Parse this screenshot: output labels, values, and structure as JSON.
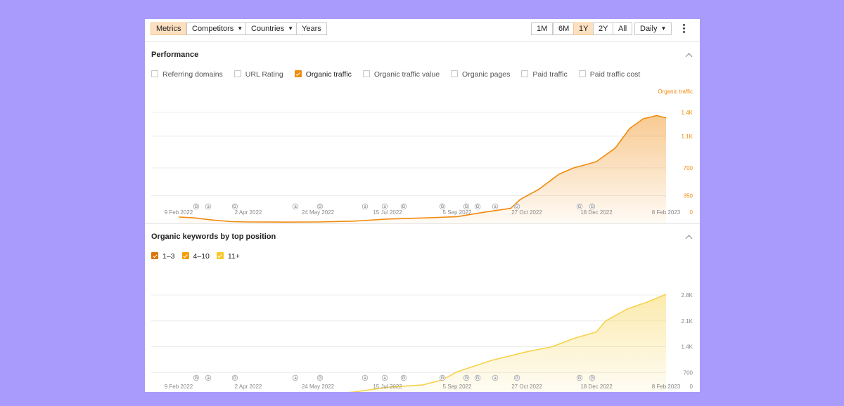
{
  "toolbar": {
    "left_buttons": [
      {
        "label": "Metrics",
        "active": true
      },
      {
        "label": "Competitors",
        "dropdown": true
      },
      {
        "label": "Countries",
        "dropdown": true
      },
      {
        "label": "Years"
      }
    ],
    "ranges": [
      {
        "label": "1M"
      },
      {
        "label": "6M"
      },
      {
        "label": "1Y",
        "active": true
      },
      {
        "label": "2Y"
      },
      {
        "label": "All"
      }
    ],
    "interval": "Daily",
    "menu_icon": "more-vertical-icon"
  },
  "performance": {
    "title": "Performance",
    "collapse_icon": "chevron-up-icon",
    "metrics": [
      {
        "label": "Referring domains",
        "checked": false
      },
      {
        "label": "URL Rating",
        "checked": false
      },
      {
        "label": "Organic traffic",
        "checked": true
      },
      {
        "label": "Organic traffic value",
        "checked": false
      },
      {
        "label": "Organic pages",
        "checked": false
      },
      {
        "label": "Paid traffic",
        "checked": false
      },
      {
        "label": "Paid traffic cost",
        "checked": false
      }
    ]
  },
  "keywords": {
    "title": "Organic keywords by top position",
    "collapse_icon": "chevron-up-icon",
    "positions": [
      {
        "label": "1–3",
        "checked": true,
        "color": "#d97706"
      },
      {
        "label": "4–10",
        "checked": true,
        "color": "#f59e0b"
      },
      {
        "label": "11+",
        "checked": true,
        "color": "#fcd34d"
      }
    ]
  },
  "colors": {
    "accent": "#f08a0c",
    "pos_1_3": "#d97706",
    "pos_4_10": "#f59e0b",
    "pos_11_plus": "#f7d24a",
    "grid": "#ececec"
  },
  "chart_data": [
    {
      "type": "area",
      "x_start": "2022-02-09",
      "x_end": "2023-02-08",
      "x_tick_labels": [
        "9 Feb 2022",
        "2 Apr 2022",
        "24 May 2022",
        "15 Jul 2022",
        "5 Sep 2022",
        "27 Oct 2022",
        "18 Dec 2022",
        "8 Feb 2023"
      ],
      "y_ticks": [
        0,
        350,
        700,
        1100,
        1400
      ],
      "y_tick_labels": [
        "0",
        "350",
        "700",
        "1.1K",
        "1.4K"
      ],
      "ylim": [
        0,
        1400
      ],
      "grid": true,
      "series": [
        {
          "name": "Organic traffic",
          "color": "#f08a0c",
          "points": [
            [
              "2022-02-09",
              80
            ],
            [
              "2022-02-20",
              70
            ],
            [
              "2022-03-05",
              45
            ],
            [
              "2022-03-20",
              22
            ],
            [
              "2022-04-02",
              18
            ],
            [
              "2022-05-01",
              16
            ],
            [
              "2022-05-24",
              18
            ],
            [
              "2022-06-20",
              28
            ],
            [
              "2022-07-15",
              55
            ],
            [
              "2022-08-15",
              70
            ],
            [
              "2022-09-05",
              85
            ],
            [
              "2022-09-25",
              140
            ],
            [
              "2022-10-15",
              190
            ],
            [
              "2022-10-22",
              300
            ],
            [
              "2022-11-05",
              430
            ],
            [
              "2022-11-20",
              620
            ],
            [
              "2022-12-01",
              700
            ],
            [
              "2022-12-10",
              740
            ],
            [
              "2022-12-18",
              780
            ],
            [
              "2023-01-01",
              950
            ],
            [
              "2023-01-12",
              1200
            ],
            [
              "2023-01-22",
              1320
            ],
            [
              "2023-02-01",
              1360
            ],
            [
              "2023-02-08",
              1330
            ]
          ]
        }
      ],
      "annotations": [
        "G",
        "a",
        "G",
        "a",
        "G",
        "a",
        "a",
        "G",
        "G",
        "G",
        "G",
        "a",
        "G",
        "G",
        "G"
      ]
    },
    {
      "type": "area",
      "x_start": "2022-02-09",
      "x_end": "2023-02-08",
      "x_tick_labels": [
        "9 Feb 2022",
        "2 Apr 2022",
        "24 May 2022",
        "15 Jul 2022",
        "5 Sep 2022",
        "27 Oct 2022",
        "18 Dec 2022",
        "8 Feb 2023"
      ],
      "y_ticks": [
        0,
        700,
        1400,
        2100,
        2800
      ],
      "y_tick_labels": [
        "0",
        "700",
        "1.4K",
        "2.1K",
        "2.8K"
      ],
      "ylim": [
        0,
        2800
      ],
      "grid": true,
      "series": [
        {
          "name": "11+",
          "color": "#f7d24a",
          "points": [
            [
              "2022-02-09",
              75
            ],
            [
              "2022-04-02",
              75
            ],
            [
              "2022-05-24",
              95
            ],
            [
              "2022-06-20",
              170
            ],
            [
              "2022-07-15",
              300
            ],
            [
              "2022-08-10",
              360
            ],
            [
              "2022-08-25",
              500
            ],
            [
              "2022-09-05",
              720
            ],
            [
              "2022-10-01",
              1030
            ],
            [
              "2022-10-27",
              1260
            ],
            [
              "2022-11-15",
              1400
            ],
            [
              "2022-12-01",
              1620
            ],
            [
              "2022-12-18",
              1800
            ],
            [
              "2022-12-25",
              2100
            ],
            [
              "2023-01-10",
              2420
            ],
            [
              "2023-01-25",
              2610
            ],
            [
              "2023-02-08",
              2820
            ]
          ]
        },
        {
          "name": "4–10",
          "color": "#f59e0b",
          "points": [
            [
              "2022-02-09",
              22
            ],
            [
              "2022-09-05",
              26
            ],
            [
              "2022-12-18",
              50
            ],
            [
              "2023-01-20",
              95
            ],
            [
              "2023-02-08",
              100
            ]
          ]
        },
        {
          "name": "1–3",
          "color": "#d97706",
          "points": [
            [
              "2022-02-09",
              10
            ],
            [
              "2022-12-18",
              14
            ],
            [
              "2023-02-08",
              18
            ]
          ]
        }
      ],
      "annotations": [
        "G",
        "a",
        "G",
        "a",
        "G",
        "a",
        "a",
        "G",
        "G",
        "G",
        "G",
        "a",
        "G",
        "G",
        "G"
      ]
    }
  ],
  "traffic_axis_title": "Organic traffic"
}
